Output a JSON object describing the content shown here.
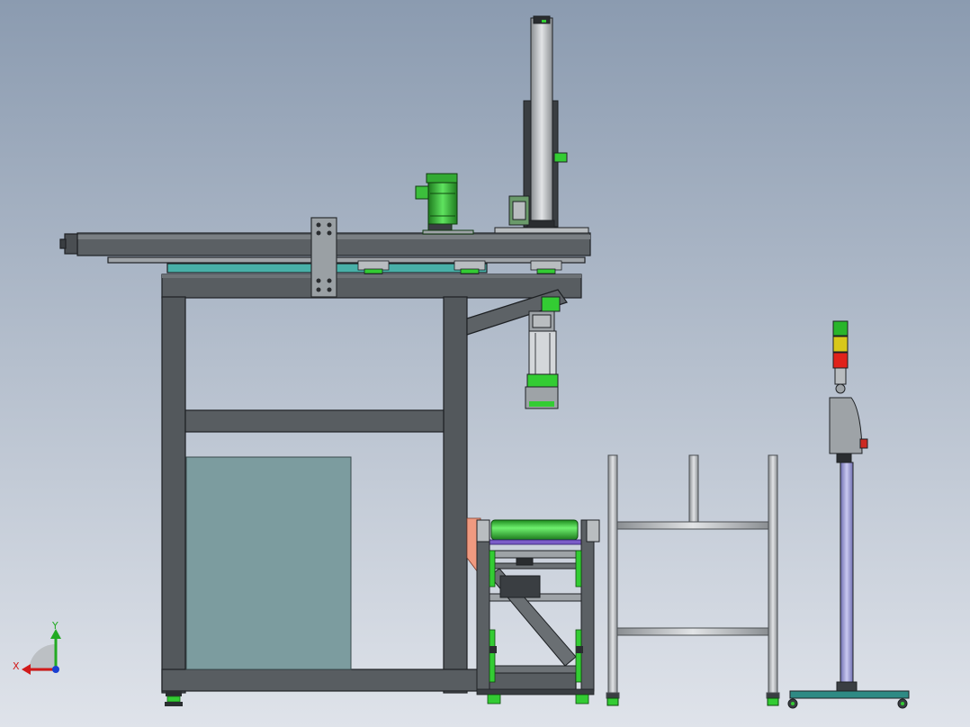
{
  "viewport": {
    "background_top": "#8b9bb0",
    "background_bottom": "#dfe3ea"
  },
  "triad": {
    "x_label": "X",
    "y_label": "Y",
    "x_color": "#d11a1a",
    "y_color": "#22aa22",
    "z_color": "#1a3fd1"
  },
  "colors": {
    "frame": "#53585c",
    "frame_edge": "#1e2124",
    "panel": "#7c9c9f",
    "green": "#33cc33",
    "teal": "#48b0a8",
    "silver": "#b9bdc0",
    "salmon": "#f09a80",
    "purple_pole": "#9a9ad6",
    "light_red": "#e0221b",
    "light_yellow": "#d8c81a",
    "light_green": "#29b52a"
  }
}
